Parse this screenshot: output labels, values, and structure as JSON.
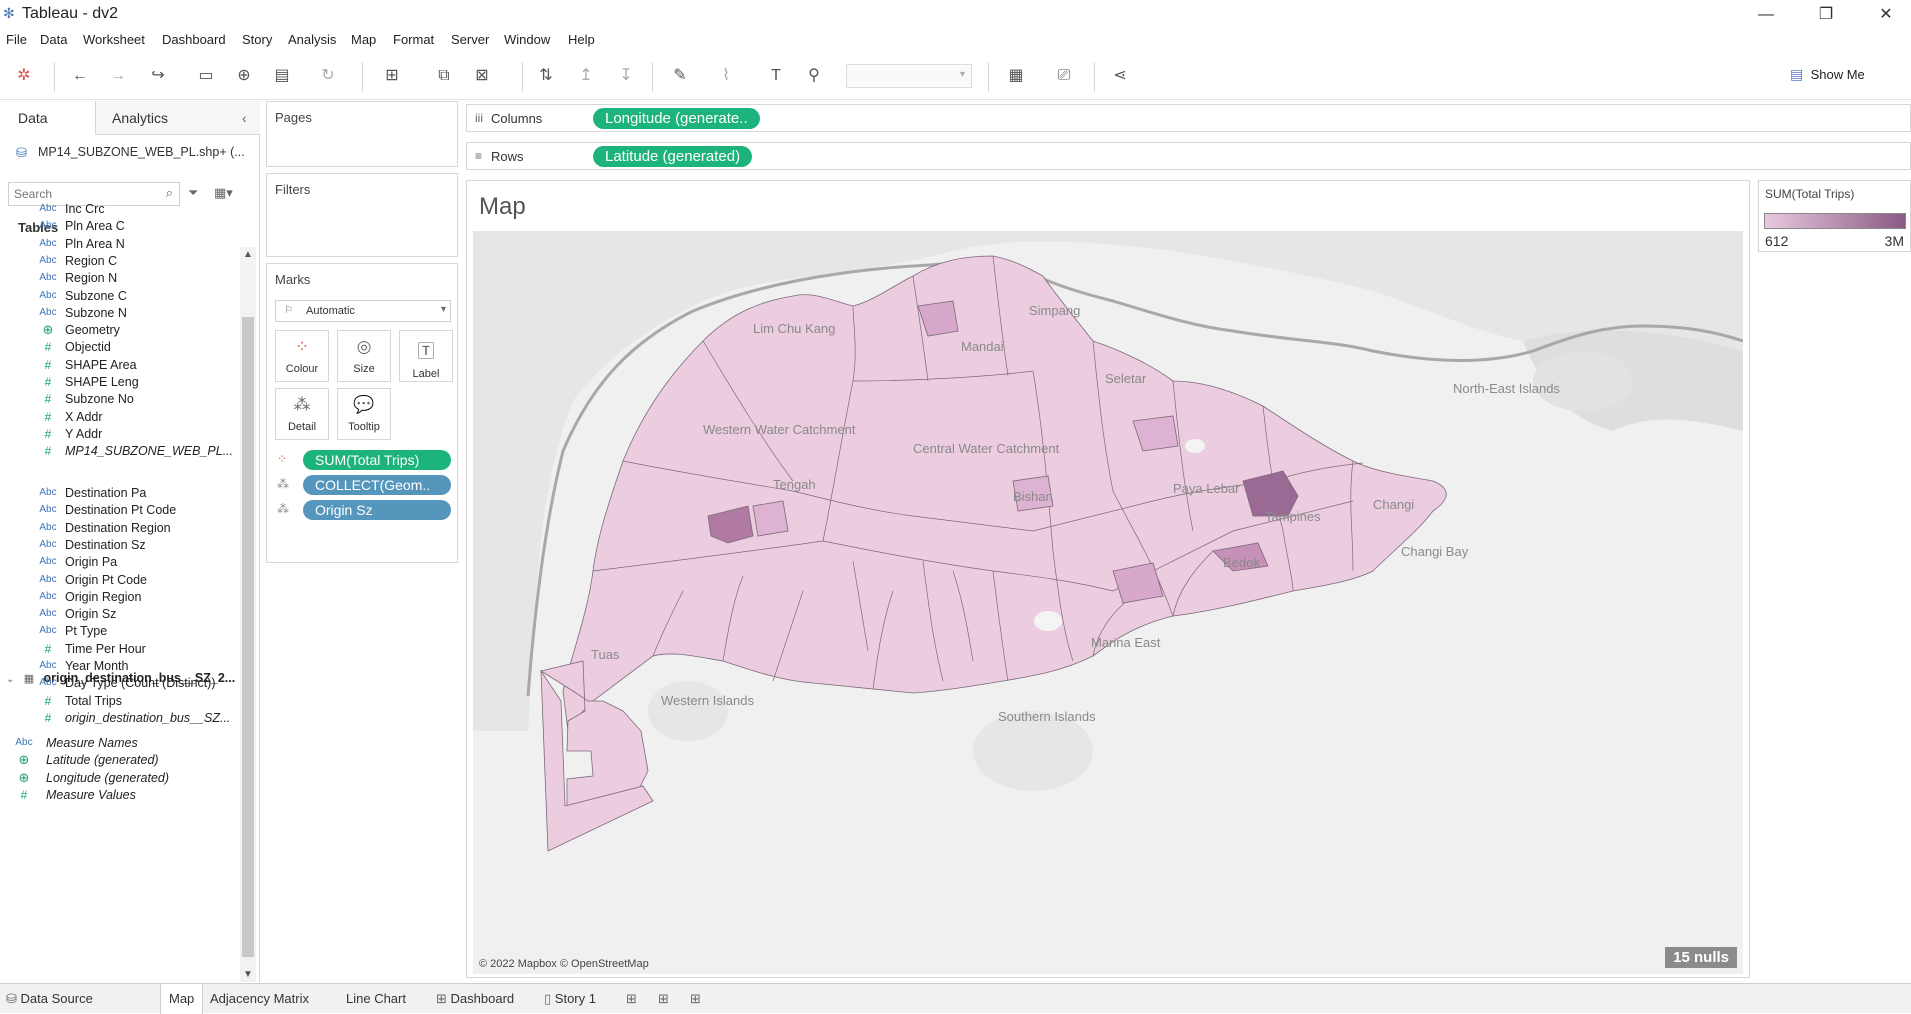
{
  "window": {
    "title": "Tableau - dv2"
  },
  "menu": [
    "File",
    "Data",
    "Worksheet",
    "Dashboard",
    "Story",
    "Analysis",
    "Map",
    "Format",
    "Server",
    "Window",
    "Help"
  ],
  "toolbar": {
    "show_me_label": "Show Me"
  },
  "left_pane": {
    "tab_data": "Data",
    "tab_analytics": "Analytics",
    "data_source": "MP14_SUBZONE_WEB_PL.shp+ (...",
    "search_placeholder": "Search",
    "tables_label": "Tables",
    "group1_fields": [
      {
        "icon": "Abc",
        "name": "Inc Crc"
      },
      {
        "icon": "Abc",
        "name": "Pln Area C"
      },
      {
        "icon": "Abc",
        "name": "Pln Area N"
      },
      {
        "icon": "Abc",
        "name": "Region C"
      },
      {
        "icon": "Abc",
        "name": "Region N"
      },
      {
        "icon": "Abc",
        "name": "Subzone C"
      },
      {
        "icon": "Abc",
        "name": "Subzone N"
      },
      {
        "icon": "globe",
        "name": "Geometry"
      },
      {
        "icon": "#",
        "name": "Objectid"
      },
      {
        "icon": "#",
        "name": "SHAPE Area"
      },
      {
        "icon": "#",
        "name": "SHAPE Leng"
      },
      {
        "icon": "#",
        "name": "Subzone No"
      },
      {
        "icon": "#",
        "name": "X Addr"
      },
      {
        "icon": "#",
        "name": "Y Addr"
      },
      {
        "icon": "#",
        "name": "MP14_SUBZONE_WEB_PL..."
      }
    ],
    "table2_name": "origin_destination_bus__SZ_2...",
    "group2_fields": [
      {
        "icon": "Abc",
        "name": "Destination Pa"
      },
      {
        "icon": "Abc",
        "name": "Destination Pt Code"
      },
      {
        "icon": "Abc",
        "name": "Destination Region"
      },
      {
        "icon": "Abc",
        "name": "Destination Sz"
      },
      {
        "icon": "Abc",
        "name": "Origin Pa"
      },
      {
        "icon": "Abc",
        "name": "Origin Pt Code"
      },
      {
        "icon": "Abc",
        "name": "Origin Region"
      },
      {
        "icon": "Abc",
        "name": "Origin Sz"
      },
      {
        "icon": "Abc",
        "name": "Pt Type"
      },
      {
        "icon": "#",
        "name": "Time Per Hour"
      },
      {
        "icon": "Abc",
        "name": "Year Month"
      },
      {
        "icon": "Abc",
        "name": "Day Type (Count (Distinct))"
      },
      {
        "icon": "#",
        "name": "Total Trips"
      },
      {
        "icon": "#",
        "name": "origin_destination_bus__SZ..."
      }
    ],
    "group3_fields": [
      {
        "icon": "Abc",
        "name": "Measure Names"
      },
      {
        "icon": "globe",
        "name": "Latitude (generated)"
      },
      {
        "icon": "globe",
        "name": "Longitude (generated)"
      },
      {
        "icon": "#",
        "name": "Measure Values"
      }
    ]
  },
  "cards": {
    "pages": "Pages",
    "filters": "Filters",
    "marks": "Marks",
    "mark_type": "Automatic",
    "buttons": [
      "Colour",
      "Size",
      "Label",
      "Detail",
      "Tooltip"
    ],
    "pills": [
      "SUM(Total Trips)",
      "COLLECT(Geom..",
      "Origin Sz"
    ]
  },
  "shelves": {
    "columns_label": "Columns",
    "columns_pill": "Longitude (generate..",
    "rows_label": "Rows",
    "rows_pill": "Latitude (generated)"
  },
  "viz": {
    "title": "Map",
    "copyright": "© 2022 Mapbox © OpenStreetMap",
    "nulls": "15 nulls",
    "places": [
      "Simpang",
      "Lim Chu Kang",
      "Western Water Catchment",
      "Central Water Catchment",
      "Tengah",
      "Mandai",
      "Seletar",
      "Bishan",
      "Paya Lebar",
      "Tampines",
      "Changi",
      "Changi Bay",
      "Bedok",
      "Marina East",
      "North-East Islands",
      "Western Islands",
      "Southern Islands",
      "Tuas"
    ]
  },
  "legend": {
    "title": "SUM(Total Trips)",
    "min": "612",
    "max": "3M",
    "color_min": "#e8c9df",
    "color_max": "#8a5a84"
  },
  "bottom_tabs": [
    "Data Source",
    "Map",
    "Adjacency Matrix",
    "Line Chart",
    "Dashboard",
    "Story 1"
  ]
}
